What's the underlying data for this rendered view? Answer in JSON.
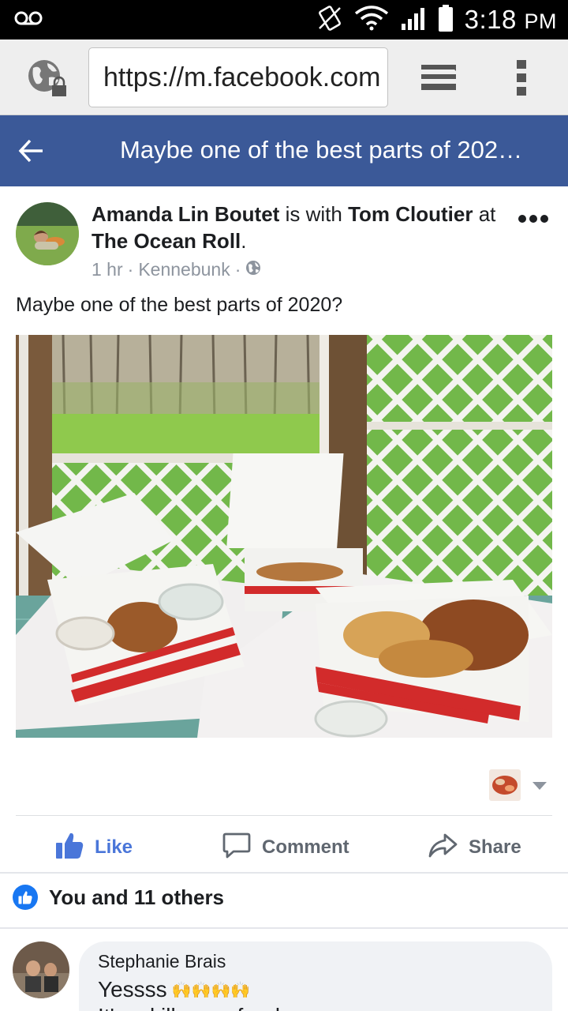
{
  "status_bar": {
    "time": "3:18",
    "ampm": "PM",
    "icons": [
      "voicemail-icon",
      "vibrate-icon",
      "wifi-icon",
      "signal-icon",
      "battery-icon"
    ]
  },
  "browser": {
    "url": "https://m.facebook.com",
    "icons": [
      "globe-icon",
      "tabs-icon",
      "overflow-menu-icon"
    ]
  },
  "header": {
    "title": "Maybe one of the best parts of 202…",
    "back_icon": "back-arrow-icon",
    "background": "#3b5998"
  },
  "post": {
    "author": "Amanda Lin Boutet",
    "with_text": "is with",
    "tagged": "Tom Cloutier",
    "at_text": "at",
    "place": "The Ocean Roll",
    "period": ".",
    "time": "1 hr",
    "location": "Kennebunk",
    "dot": "·",
    "privacy_icon": "public-globe-icon",
    "text": "Maybe one of the best parts of 2020?"
  },
  "actions": {
    "like": "Like",
    "comment": "Comment",
    "share": "Share",
    "like_color": "#4a76d9"
  },
  "reactions": {
    "summary": "You and 11 others"
  },
  "comment": {
    "author": "Stephanie Brais",
    "text": "Yessss",
    "emoji": "🙌🙌🙌🙌",
    "text_line2": "It's a killer seafood…"
  }
}
